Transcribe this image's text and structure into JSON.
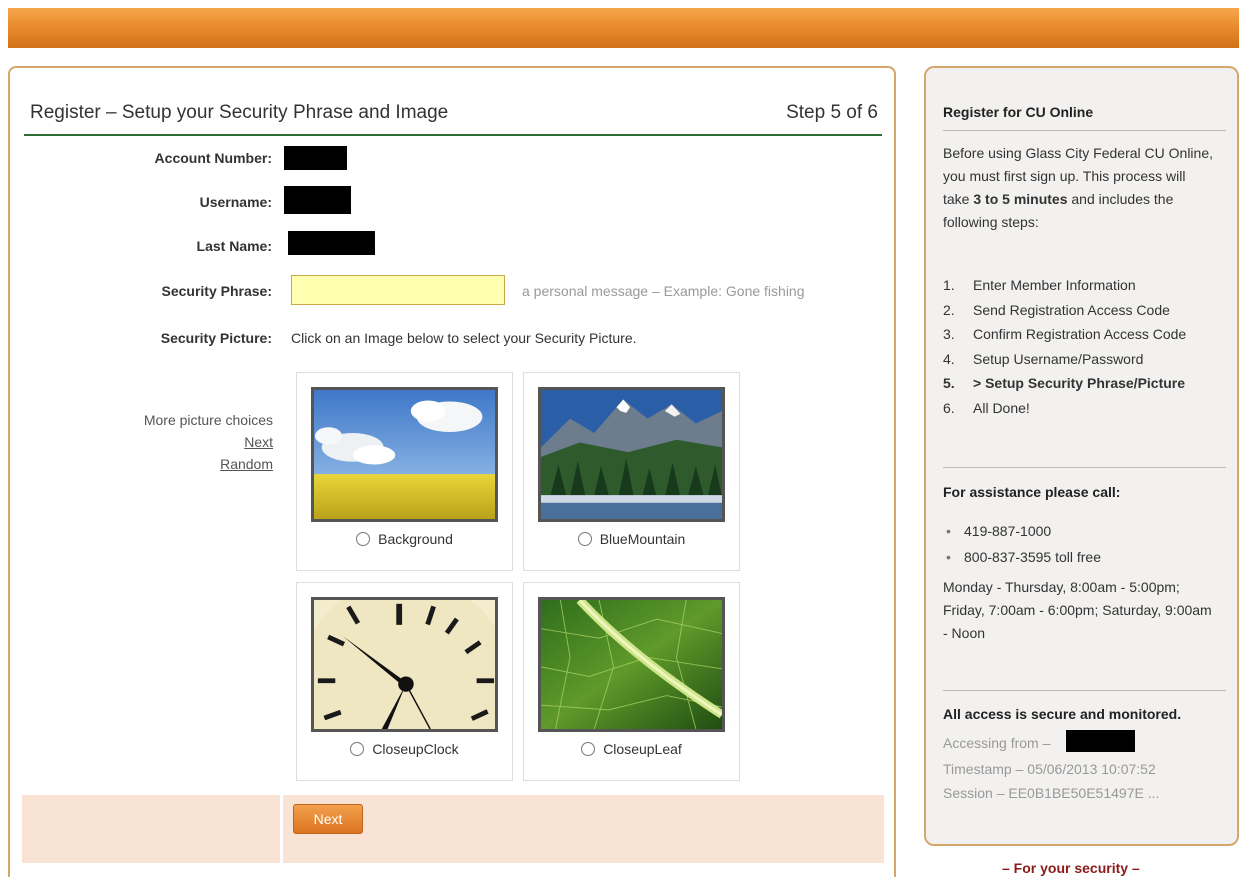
{
  "header": {
    "title": "Register – Setup your Security Phrase and Image",
    "step": "Step 5 of 6"
  },
  "form": {
    "account_number_label": "Account Number:",
    "username_label": "Username:",
    "last_name_label": "Last Name:",
    "security_phrase_label": "Security Phrase:",
    "security_phrase_value": "",
    "security_phrase_hint": "a personal message – Example: Gone fishing",
    "security_picture_label": "Security Picture:",
    "security_picture_instruction": "Click on an Image below to select your Security Picture."
  },
  "more_choices": {
    "label": "More picture choices",
    "next": "Next",
    "random": "Random"
  },
  "pictures": [
    {
      "label": "Background",
      "icon": "sky-field-image"
    },
    {
      "label": "BlueMountain",
      "icon": "mountain-image"
    },
    {
      "label": "CloseupClock",
      "icon": "clock-image"
    },
    {
      "label": "CloseupLeaf",
      "icon": "leaf-image"
    }
  ],
  "actions": {
    "next_label": "Next"
  },
  "sidebar": {
    "register_heading": "Register for CU Online",
    "intro_before": "Before using Glass City Federal CU Online, you must first sign up. This process will take ",
    "intro_bold": "3 to 5 minutes",
    "intro_after": " and includes the following steps:",
    "steps": [
      {
        "num": "1.",
        "label": "Enter Member Information"
      },
      {
        "num": "2.",
        "label": "Send Registration Access Code"
      },
      {
        "num": "3.",
        "label": "Confirm Registration Access Code"
      },
      {
        "num": "4.",
        "label": "Setup Username/Password"
      },
      {
        "num": "5.",
        "label": "> Setup Security Phrase/Picture"
      },
      {
        "num": "6.",
        "label": "All Done!"
      }
    ],
    "assistance_heading": "For assistance please call:",
    "phones": [
      "419-887-1000",
      "800-837-3595 toll free"
    ],
    "hours": "Monday - Thursday, 8:00am - 5:00pm; Friday, 7:00am - 6:00pm; Saturday, 9:00am - Noon",
    "secure_heading": "All access is secure and monitored.",
    "accessing_from": "Accessing from –",
    "timestamp": "Timestamp – 05/06/2013 10:07:52",
    "session": "Session – EE0B1BE50E51497E ..."
  },
  "footer": {
    "security_text": "– For your security –"
  },
  "colors": {
    "top_bar": "#e8862a",
    "panel_border": "#d4a86a",
    "header_rule": "#2e6b35",
    "phrase_input_bg": "#ffffb0",
    "action_row_bg": "#f8e3d4",
    "button_orange": "#e07c24",
    "sidebar_bg": "#f2f1ef",
    "footer_red": "#8b1a1a"
  }
}
